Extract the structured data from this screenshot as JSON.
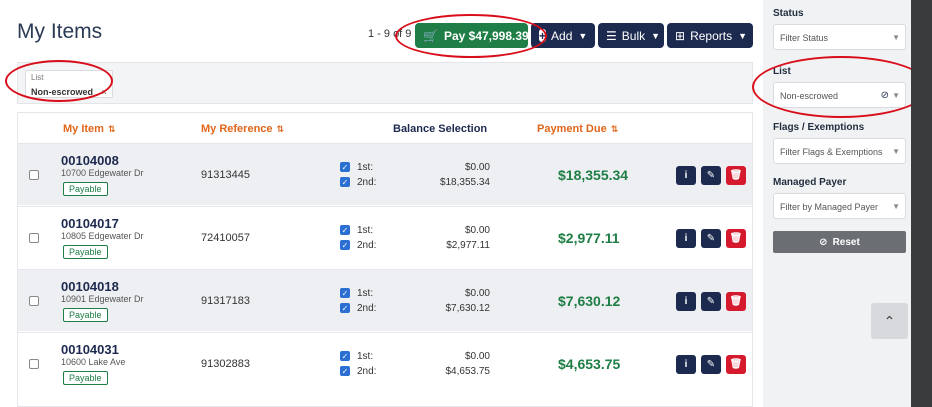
{
  "page": {
    "title": "My Items",
    "count": "1 - 9 of 9"
  },
  "toolbar": {
    "pay_label": "Pay $47,998.39",
    "add_label": "Add",
    "bulk_label": "Bulk",
    "reports_label": "Reports"
  },
  "filter_chip": {
    "label": "List",
    "value": "Non-escrowed",
    "remove": "×"
  },
  "table": {
    "columns": [
      "My Item",
      "My Reference",
      "Balance Selection",
      "Payment Due"
    ],
    "rows": [
      {
        "item": "00104008",
        "address": "10700 Edgewater Dr",
        "status": "Payable",
        "reference": "91313445",
        "first_label": "1st:",
        "first_amount": "$0.00",
        "second_label": "2nd:",
        "second_amount": "$18,355.34",
        "due": "$18,355.34"
      },
      {
        "item": "00104017",
        "address": "10805 Edgewater Dr",
        "status": "Payable",
        "reference": "72410057",
        "first_label": "1st:",
        "first_amount": "$0.00",
        "second_label": "2nd:",
        "second_amount": "$2,977.11",
        "due": "$2,977.11"
      },
      {
        "item": "00104018",
        "address": "10901 Edgewater Dr",
        "status": "Payable",
        "reference": "91317183",
        "first_label": "1st:",
        "first_amount": "$0.00",
        "second_label": "2nd:",
        "second_amount": "$7,630.12",
        "due": "$7,630.12"
      },
      {
        "item": "00104031",
        "address": "10600 Lake Ave",
        "status": "Payable",
        "reference": "91302883",
        "first_label": "1st:",
        "first_amount": "$0.00",
        "second_label": "2nd:",
        "second_amount": "$4,653.75",
        "due": "$4,653.75"
      }
    ]
  },
  "sidebar": {
    "status_label": "Status",
    "status_placeholder": "Filter Status",
    "list_label": "List",
    "list_value": "Non-escrowed",
    "flags_label": "Flags / Exemptions",
    "flags_placeholder": "Filter Flags & Exemptions",
    "payer_label": "Managed Payer",
    "payer_placeholder": "Filter by Managed Payer",
    "reset_label": "Reset"
  },
  "colors": {
    "navy": "#1d2a4f",
    "green": "#1e7e45",
    "orange": "#e0661b",
    "red": "#d61a2e",
    "highlight": "#d80f1b"
  }
}
